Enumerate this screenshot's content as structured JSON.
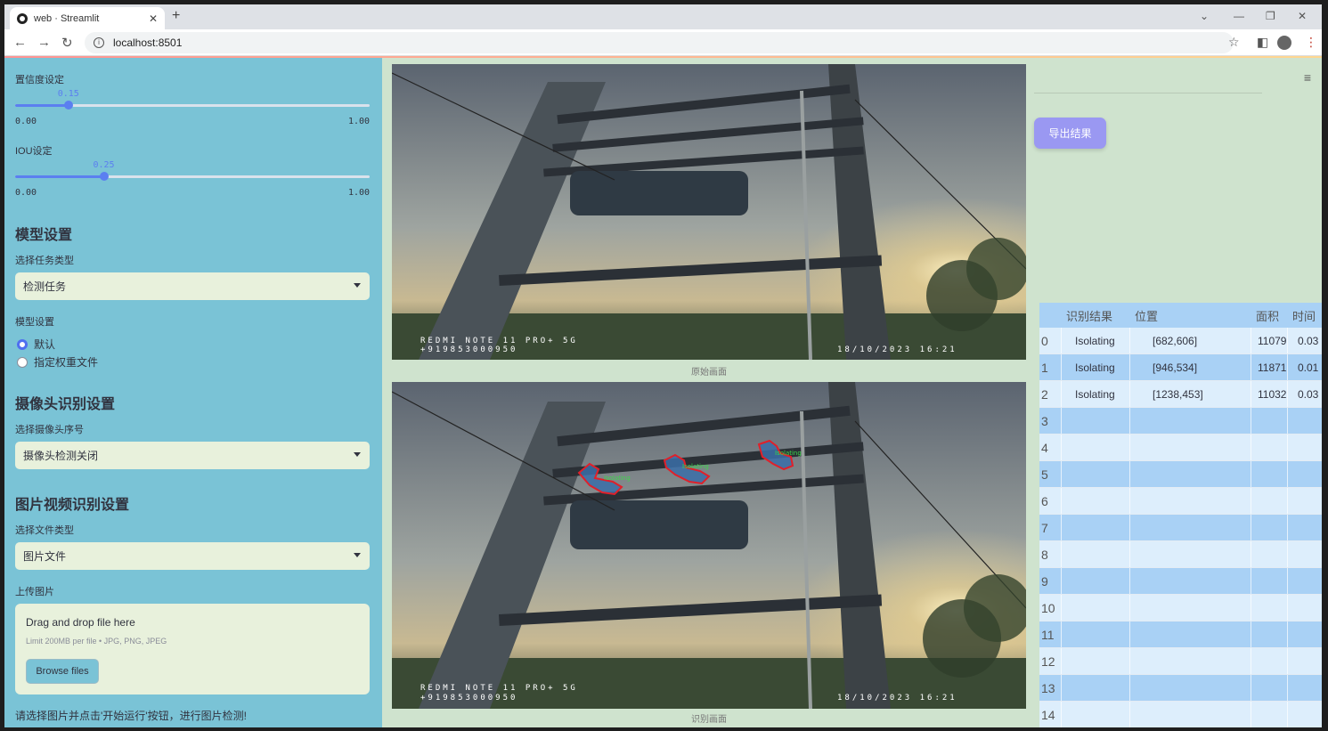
{
  "browser": {
    "tab_title": "web · Streamlit",
    "url": "localhost:8501"
  },
  "sidebar": {
    "confidence": {
      "label": "置信度设定",
      "value": 0.15,
      "value_text": "0.15",
      "min": "0.00",
      "max": "1.00"
    },
    "iou": {
      "label": "IOU设定",
      "value": 0.25,
      "value_text": "0.25",
      "min": "0.00",
      "max": "1.00"
    },
    "model_section": "模型设置",
    "task_label": "选择任务类型",
    "task_value": "检测任务",
    "model_label": "模型设置",
    "model_options": [
      "默认",
      "指定权重文件"
    ],
    "model_selected": 0,
    "camera_section": "摄像头识别设置",
    "camera_label": "选择摄像头序号",
    "camera_value": "摄像头检测关闭",
    "media_section": "图片视频识别设置",
    "file_type_label": "选择文件类型",
    "file_type_value": "图片文件",
    "upload_label": "上传图片",
    "uploader": {
      "drag_text": "Drag and drop file here",
      "limit_text": "Limit 200MB per file • JPG, PNG, JPEG",
      "browse_label": "Browse files"
    },
    "hint": "请选择图片并点击'开始运行'按钮，进行图片检测!"
  },
  "main": {
    "original_caption": "原始画面",
    "result_caption": "识别画面",
    "photo_overlay_line1": "REDMI NOTE 11 PRO+ 5G",
    "photo_overlay_line2": "+919853000950",
    "photo_timestamp": "18/10/2023  16:21",
    "detection_label": "Isolating",
    "export_button": "导出结果"
  },
  "table": {
    "headers": [
      "识别结果",
      "位置",
      "面积",
      "时间"
    ],
    "rows": [
      {
        "index": "0",
        "result": "Isolating",
        "position": "[682,606]",
        "area": "11079",
        "time": "0.03"
      },
      {
        "index": "1",
        "result": "Isolating",
        "position": "[946,534]",
        "area": "11871",
        "time": "0.01"
      },
      {
        "index": "2",
        "result": "Isolating",
        "position": "[1238,453]",
        "area": "11032",
        "time": "0.03"
      },
      {
        "index": "3"
      },
      {
        "index": "4"
      },
      {
        "index": "5"
      },
      {
        "index": "6"
      },
      {
        "index": "7"
      },
      {
        "index": "8"
      },
      {
        "index": "9"
      },
      {
        "index": "10"
      },
      {
        "index": "11"
      },
      {
        "index": "12"
      },
      {
        "index": "13"
      },
      {
        "index": "14"
      }
    ]
  },
  "colors": {
    "sidebar_bg": "#7ac3d6",
    "main_bg": "#cfe3ce",
    "slider_accent": "#5b7ff0",
    "export_button": "#9a98f2",
    "table_row_alt": "#a9d1f5",
    "detection_box": "#e0202a",
    "detection_fill": "#3b6fa8"
  }
}
